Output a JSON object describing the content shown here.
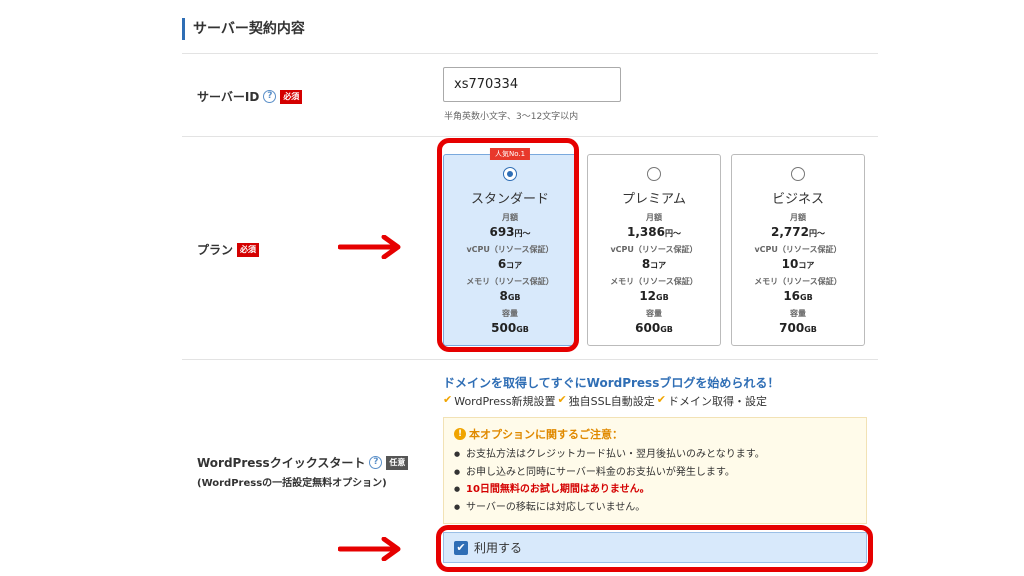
{
  "section": {
    "title": "サーバー契約内容"
  },
  "server_id": {
    "label": "サーバーID",
    "help": "?",
    "required": "必須",
    "value": "xs770334",
    "hint": "半角英数小文字、3～12文字以内"
  },
  "plan": {
    "label": "プラン",
    "required": "必須",
    "popular_badge": "人気No.1",
    "selected": "スタンダード",
    "options": [
      {
        "name": "スタンダード",
        "price_label": "月額",
        "price": "693",
        "price_unit": "円～",
        "vcpu_label": "vCPU（リソース保証）",
        "vcpu": "6",
        "vcpu_unit": "コア",
        "mem_label": "メモリ（リソース保証）",
        "mem": "8",
        "mem_unit": "GB",
        "disk_label": "容量",
        "disk": "500",
        "disk_unit": "GB"
      },
      {
        "name": "プレミアム",
        "price_label": "月額",
        "price": "1,386",
        "price_unit": "円～",
        "vcpu_label": "vCPU（リソース保証）",
        "vcpu": "8",
        "vcpu_unit": "コア",
        "mem_label": "メモリ（リソース保証）",
        "mem": "12",
        "mem_unit": "GB",
        "disk_label": "容量",
        "disk": "600",
        "disk_unit": "GB"
      },
      {
        "name": "ビジネス",
        "price_label": "月額",
        "price": "2,772",
        "price_unit": "円～",
        "vcpu_label": "vCPU（リソース保証）",
        "vcpu": "10",
        "vcpu_unit": "コア",
        "mem_label": "メモリ（リソース保証）",
        "mem": "16",
        "mem_unit": "GB",
        "disk_label": "容量",
        "disk": "700",
        "disk_unit": "GB"
      }
    ]
  },
  "wordpress": {
    "label": "WordPressクイックスタート",
    "help": "?",
    "optional": "任意",
    "sub_label": "(WordPressの一括設定無料オプション)",
    "headline": "ドメインを取得してすぐにWordPressブログを始められる！",
    "check": "✔",
    "features": [
      "WordPress新規設置",
      "独自SSL自動設定",
      "ドメイン取得・設定"
    ],
    "notice_icon": "!",
    "notice_title": "本オプションに関するご注意：",
    "notice_items": [
      "お支払方法はクレジットカード払い・翌月後払いのみとなります。",
      "お申し込みと同時にサーバー料金のお支払いが発生します。",
      "10日間無料のお試し期間はありません。",
      "サーバーの移転には対応していません。"
    ],
    "use_checkbox_mark": "✔",
    "use_label": "利用する",
    "use_checked": true
  },
  "colors": {
    "accent": "#2f6eb5",
    "annotation_red": "#e60000",
    "required_red": "#d40000"
  },
  "icons": [
    "help-icon",
    "radio-icon",
    "check-icon",
    "warning-icon",
    "arrow-right-icon"
  ]
}
